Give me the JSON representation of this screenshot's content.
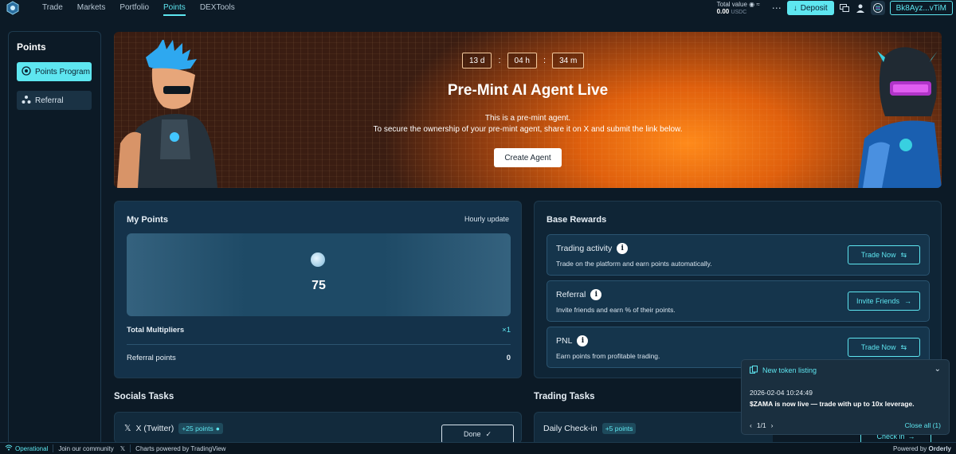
{
  "nav": {
    "items": [
      {
        "label": "Trade",
        "active": false
      },
      {
        "label": "Markets",
        "active": false
      },
      {
        "label": "Portfolio",
        "active": false
      },
      {
        "label": "Points",
        "active": true
      },
      {
        "label": "DEXTools",
        "active": false
      }
    ],
    "total_value_label": "Total value",
    "total_value": "0.00",
    "total_value_unit": "USDC",
    "deposit_label": "Deposit",
    "wallet_address": "Bk8Ayz...vTiM"
  },
  "sidebar": {
    "title": "Points",
    "items": [
      {
        "label": "Points Program",
        "icon": "points-icon",
        "active": true
      },
      {
        "label": "Referral",
        "icon": "referral-icon",
        "active": false
      }
    ]
  },
  "banner": {
    "countdown": {
      "days": "13 d",
      "hours": "04 h",
      "minutes": "34 m"
    },
    "title": "Pre-Mint AI Agent Live",
    "line1": "This is a pre-mint agent.",
    "line2": "To secure the ownership of your pre-mint agent, share it on X and submit the link below.",
    "cta": "Create Agent"
  },
  "my_points": {
    "title": "My Points",
    "update_note": "Hourly update",
    "value": "75",
    "total_multipliers_label": "Total Multipliers",
    "total_multipliers_value": "×1",
    "referral_points_label": "Referral points",
    "referral_points_value": "0"
  },
  "base_rewards": {
    "title": "Base Rewards",
    "items": [
      {
        "title": "Trading activity",
        "desc": "Trade on the platform and earn points automatically.",
        "button": "Trade Now",
        "button_icon": "swap-icon"
      },
      {
        "title": "Referral",
        "desc": "Invite friends and earn % of their points.",
        "button": "Invite Friends",
        "button_icon": "arrow-right-icon"
      },
      {
        "title": "PNL",
        "desc": "Earn points from profitable trading.",
        "button": "Trade Now",
        "button_icon": "swap-icon"
      }
    ]
  },
  "socials_tasks": {
    "title": "Socials Tasks",
    "x_task_label": "X (Twitter)",
    "x_task_points": "+25 points",
    "done_label": "Done"
  },
  "trading_tasks": {
    "title": "Trading Tasks",
    "daily_label": "Daily Check-in",
    "daily_points": "+5 points",
    "checkin_label": "Check in"
  },
  "notification": {
    "title": "New token listing",
    "timestamp": "2026-02-04 10:24:49",
    "message": "$ZAMA is now live — trade with up to 10x leverage.",
    "pager": "1/1",
    "close_all": "Close all (1)"
  },
  "status_bar": {
    "status": "Operational",
    "community": "Join our community",
    "charts": "Charts powered by TradingView",
    "powered_by": "Powered by",
    "powered_brand": "Orderly"
  },
  "colors": {
    "accent": "#5ee6f0",
    "background": "#0c1a26",
    "card": "#14324a",
    "banner_orange": "#e0600d"
  }
}
